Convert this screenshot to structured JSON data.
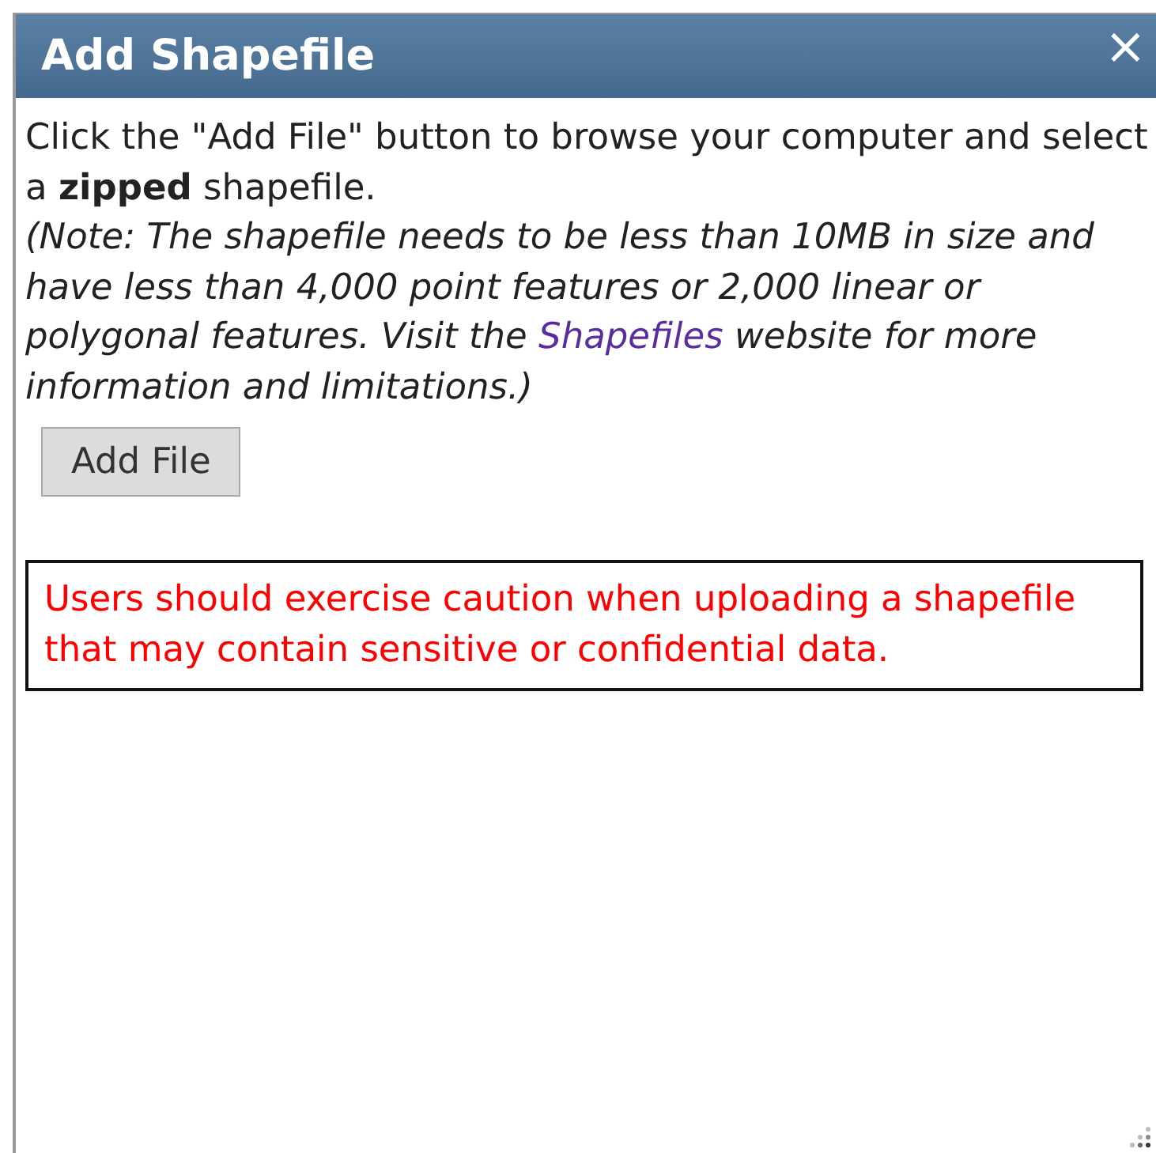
{
  "window": {
    "title": "Add Shapefile",
    "close": "×"
  },
  "intro": "Click the \"Add File\" button to browse your computer and select a **zipped** shapefile.",
  "note": {
    "before": "(Note: The shapefile needs to be less than 10MB in size and have less than 4,000 point features or 2,000 linear or polygonal features. Visit the ",
    "link": "Shapefiles",
    "after": " website for more information and limitations.)"
  },
  "add_button": "Add File",
  "warning": "Users should exercise caution when uploading a shapefile that may contain sensitive or confidential data."
}
